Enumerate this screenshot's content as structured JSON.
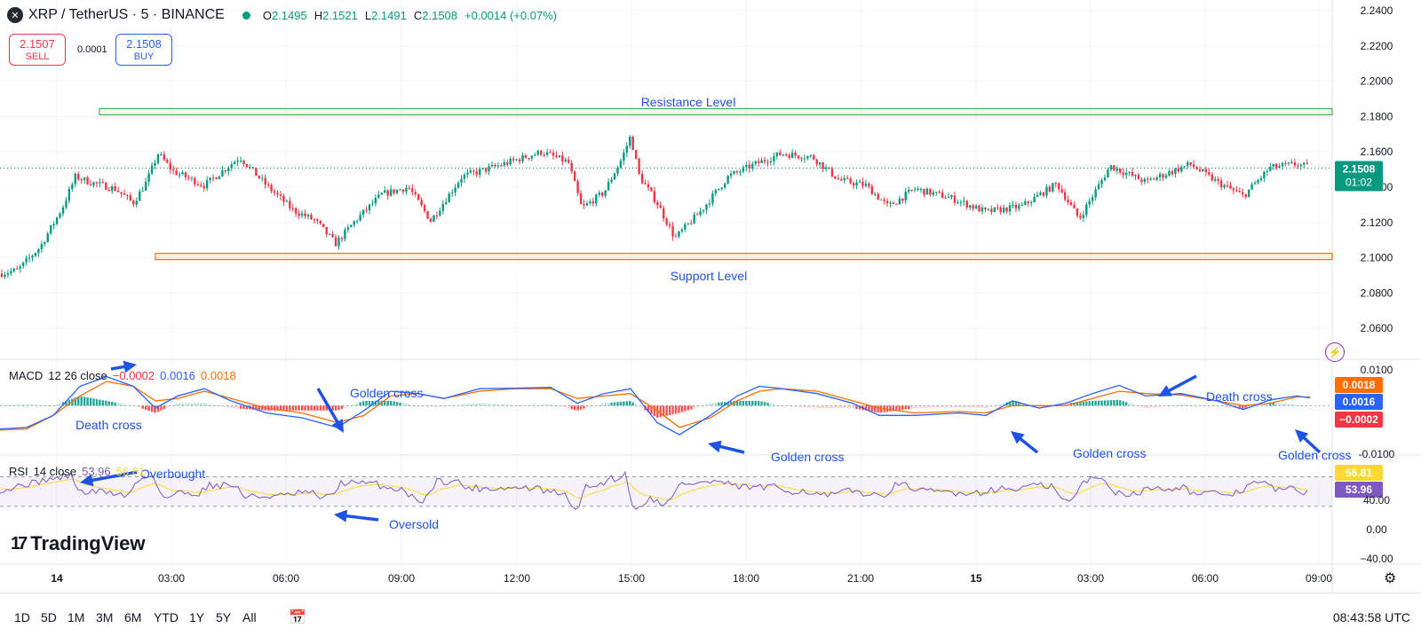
{
  "header": {
    "symbol": "XRP / TetherUS · 5 · BINANCE",
    "logo_icon": "xrp-logo-icon",
    "open_label": "O",
    "open": "2.1495",
    "high_label": "H",
    "high": "2.1521",
    "low_label": "L",
    "low": "2.1491",
    "close_label": "C",
    "close": "2.1508",
    "change": "+0.0014 (+0.07%)"
  },
  "trade": {
    "sell_price": "2.1507",
    "sell_label": "SELL",
    "spread": "0.0001",
    "buy_price": "2.1508",
    "buy_label": "BUY"
  },
  "price_badge": {
    "price": "2.1508",
    "countdown": "01:02"
  },
  "macd_label": {
    "name": "MACD",
    "params": "12 26 close",
    "hist": "−0.0002",
    "macd": "0.0016",
    "signal": "0.0018"
  },
  "rsi_label": {
    "name": "RSI",
    "params": "14 close",
    "rsi": "53.96",
    "ma": "56.81"
  },
  "branding": {
    "name": "TradingView"
  },
  "ranges": [
    "1D",
    "5D",
    "1M",
    "3M",
    "6M",
    "YTD",
    "1Y",
    "5Y",
    "All"
  ],
  "clock": "08:43:58 UTC",
  "colors": {
    "up": "#089981",
    "down": "#f23645",
    "macd": "#2962ff",
    "signal": "#ff6d00",
    "rsi": "#7e57c2",
    "rsi_ma": "#fdd835",
    "annotation": "#1e53e5"
  },
  "chart_data": [
    {
      "type": "candlestick",
      "title": "XRP / TetherUS · 5 · BINANCE",
      "ylim": [
        2.05,
        2.24
      ],
      "y_ticks": [
        "2.2400",
        "2.2200",
        "2.2000",
        "2.1800",
        "2.1600",
        "2.1400",
        "2.1200",
        "2.1000",
        "2.0800",
        "2.0600"
      ],
      "x_ticks": [
        "14",
        "03:00",
        "06:00",
        "09:00",
        "12:00",
        "15:00",
        "18:00",
        "21:00",
        "15",
        "03:00",
        "06:00",
        "09:00"
      ],
      "current_price": 2.1508,
      "close_path": [
        [
          0,
          2.091
        ],
        [
          20,
          2.093
        ],
        [
          45,
          2.106
        ],
        [
          70,
          2.128
        ],
        [
          85,
          2.146
        ],
        [
          100,
          2.143
        ],
        [
          130,
          2.139
        ],
        [
          150,
          2.131
        ],
        [
          165,
          2.143
        ],
        [
          178,
          2.159
        ],
        [
          195,
          2.149
        ],
        [
          230,
          2.141
        ],
        [
          270,
          2.157
        ],
        [
          300,
          2.141
        ],
        [
          330,
          2.127
        ],
        [
          355,
          2.121
        ],
        [
          378,
          2.108
        ],
        [
          400,
          2.121
        ],
        [
          430,
          2.136
        ],
        [
          460,
          2.14
        ],
        [
          485,
          2.121
        ],
        [
          520,
          2.146
        ],
        [
          560,
          2.152
        ],
        [
          610,
          2.16
        ],
        [
          640,
          2.154
        ],
        [
          655,
          2.128
        ],
        [
          680,
          2.137
        ],
        [
          700,
          2.156
        ],
        [
          710,
          2.169
        ],
        [
          720,
          2.146
        ],
        [
          740,
          2.131
        ],
        [
          760,
          2.111
        ],
        [
          790,
          2.127
        ],
        [
          820,
          2.146
        ],
        [
          850,
          2.153
        ],
        [
          880,
          2.159
        ],
        [
          915,
          2.157
        ],
        [
          945,
          2.144
        ],
        [
          975,
          2.141
        ],
        [
          1000,
          2.129
        ],
        [
          1030,
          2.139
        ],
        [
          1070,
          2.134
        ],
        [
          1110,
          2.126
        ],
        [
          1150,
          2.129
        ],
        [
          1190,
          2.142
        ],
        [
          1215,
          2.122
        ],
        [
          1250,
          2.152
        ],
        [
          1290,
          2.143
        ],
        [
          1340,
          2.153
        ],
        [
          1370,
          2.143
        ],
        [
          1400,
          2.135
        ],
        [
          1430,
          2.151
        ],
        [
          1460,
          2.153
        ],
        [
          1475,
          2.151
        ]
      ],
      "annotations": [
        {
          "label": "Resistance Level",
          "y_low": 2.1825,
          "y_high": 2.1845
        },
        {
          "label": "Support Level",
          "y_low": 2.1005,
          "y_high": 2.1025
        }
      ]
    },
    {
      "type": "line",
      "title": "MACD 12 26 close",
      "ylim": [
        -0.01,
        0.0072
      ],
      "y_ticks": [
        "-0.0100"
      ],
      "series": [
        {
          "name": "MACD",
          "values": [
            [
              0,
              -0.0048
            ],
            [
              30,
              -0.0045
            ],
            [
              60,
              -0.002
            ],
            [
              90,
              0.004
            ],
            [
              120,
              0.006
            ],
            [
              150,
              0.004
            ],
            [
              175,
              -0.0005
            ],
            [
              200,
              0.002
            ],
            [
              230,
              0.0035
            ],
            [
              260,
              0.001
            ],
            [
              300,
              -0.0015
            ],
            [
              340,
              -0.0025
            ],
            [
              380,
              -0.0045
            ],
            [
              410,
              -0.001
            ],
            [
              440,
              0.003
            ],
            [
              470,
              0.0025
            ],
            [
              500,
              0.0015
            ],
            [
              540,
              0.0035
            ],
            [
              580,
              0.0036
            ],
            [
              620,
              0.0038
            ],
            [
              650,
              0.0005
            ],
            [
              680,
              0.0025
            ],
            [
              710,
              0.0035
            ],
            [
              740,
              -0.0035
            ],
            [
              765,
              -0.006
            ],
            [
              800,
              -0.002
            ],
            [
              830,
              0.002
            ],
            [
              855,
              0.004
            ],
            [
              880,
              0.0035
            ],
            [
              920,
              0.0025
            ],
            [
              960,
              0.0005
            ],
            [
              990,
              -0.002
            ],
            [
              1030,
              -0.002
            ],
            [
              1080,
              -0.0015
            ],
            [
              1110,
              -0.002
            ],
            [
              1140,
              0.001
            ],
            [
              1170,
              -0.0005
            ],
            [
              1200,
              0.0005
            ],
            [
              1230,
              0.0025
            ],
            [
              1260,
              0.0042
            ],
            [
              1290,
              0.002
            ],
            [
              1330,
              0.0025
            ],
            [
              1370,
              0.001
            ],
            [
              1400,
              -0.0008
            ],
            [
              1430,
              0.0012
            ],
            [
              1460,
              0.002
            ],
            [
              1475,
              0.0016
            ]
          ]
        },
        {
          "name": "Signal",
          "values": [
            [
              0,
              -0.005
            ],
            [
              30,
              -0.0048
            ],
            [
              60,
              -0.002
            ],
            [
              90,
              0.002
            ],
            [
              120,
              0.005
            ],
            [
              150,
              0.004
            ],
            [
              175,
              0.001
            ],
            [
              200,
              0.0015
            ],
            [
              230,
              0.003
            ],
            [
              260,
              0.0015
            ],
            [
              300,
              -0.0005
            ],
            [
              340,
              -0.0015
            ],
            [
              380,
              -0.0035
            ],
            [
              410,
              -0.002
            ],
            [
              440,
              0.002
            ],
            [
              470,
              0.0025
            ],
            [
              500,
              0.0015
            ],
            [
              540,
              0.003
            ],
            [
              580,
              0.0035
            ],
            [
              620,
              0.0035
            ],
            [
              650,
              0.0015
            ],
            [
              680,
              0.002
            ],
            [
              710,
              0.0025
            ],
            [
              740,
              -0.001
            ],
            [
              765,
              -0.0045
            ],
            [
              800,
              -0.0025
            ],
            [
              830,
              0.001
            ],
            [
              855,
              0.003
            ],
            [
              880,
              0.0035
            ],
            [
              920,
              0.003
            ],
            [
              960,
              0.001
            ],
            [
              990,
              -0.0005
            ],
            [
              1030,
              -0.0015
            ],
            [
              1080,
              -0.0012
            ],
            [
              1110,
              -0.0015
            ],
            [
              1140,
              0.0
            ],
            [
              1170,
              0.0
            ],
            [
              1200,
              0.0
            ],
            [
              1230,
              0.0015
            ],
            [
              1260,
              0.003
            ],
            [
              1290,
              0.0025
            ],
            [
              1330,
              0.0022
            ],
            [
              1370,
              0.001
            ],
            [
              1400,
              0.0
            ],
            [
              1430,
              0.0005
            ],
            [
              1460,
              0.0018
            ],
            [
              1475,
              0.0018
            ]
          ]
        }
      ],
      "annotations": [
        "Death cross",
        "Golden cross",
        "Golden cross",
        "Golden cross",
        "Death cross",
        "Golden cross"
      ]
    },
    {
      "type": "line",
      "title": "RSI 14 close",
      "ylim": [
        -40,
        56.81
      ],
      "y_ticks": [
        "40.00",
        "0.00",
        "−40.00"
      ],
      "series": [
        {
          "name": "RSI",
          "values": [
            53.96
          ]
        },
        {
          "name": "RSI MA",
          "values": [
            56.81
          ]
        }
      ],
      "annotations": [
        "Overbought",
        "Oversold"
      ]
    }
  ]
}
